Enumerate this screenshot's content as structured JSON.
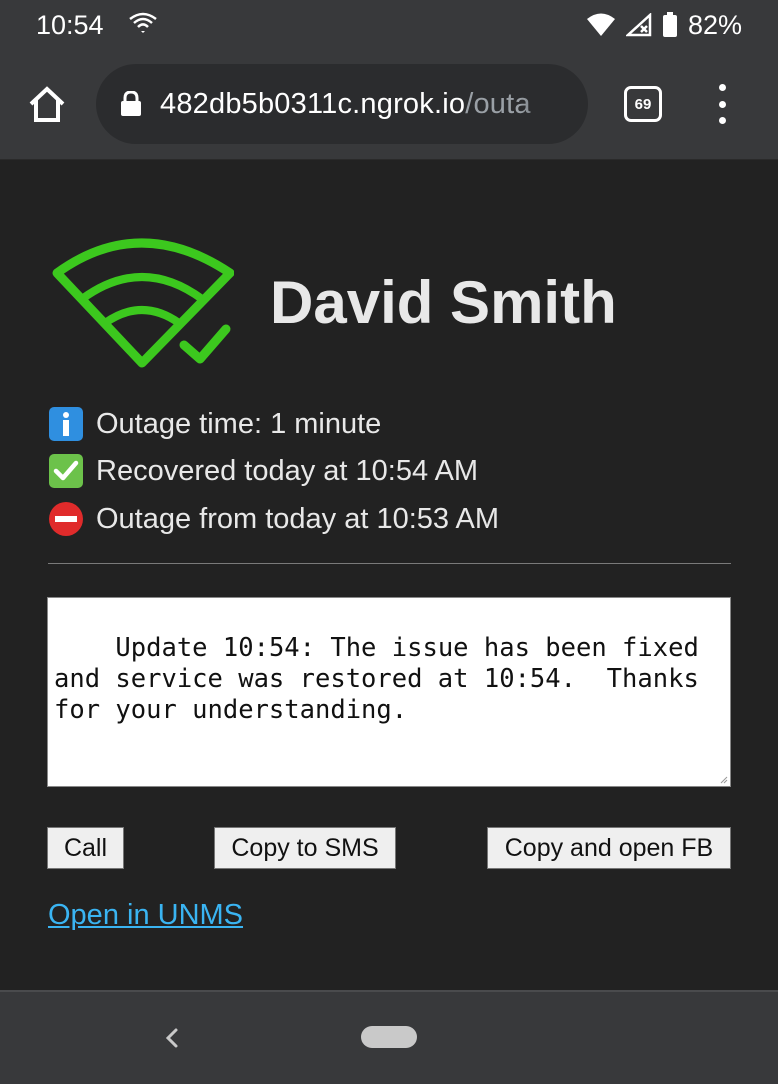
{
  "status_bar": {
    "time": "10:54",
    "battery": "82%"
  },
  "browser": {
    "url_host": "482db5b0311c.ngrok.io",
    "url_path": "/outa",
    "tab_count": "69"
  },
  "page": {
    "customer_name": "David Smith",
    "outage_time": "Outage time: 1 minute",
    "recovered": "Recovered today at 10:54 AM",
    "outage_from": "Outage from today at 10:53 AM",
    "message": "Update 10:54: The issue has been fixed and service was restored at 10:54.  Thanks for your understanding.",
    "buttons": {
      "call": "Call",
      "copy_sms": "Copy to SMS",
      "copy_fb": "Copy and open FB"
    },
    "unms_link": "Open in UNMS"
  },
  "colors": {
    "wifi_green": "#3cc81e",
    "link_blue": "#3ab4f2",
    "page_bg": "#222222"
  },
  "icons": {
    "info": "info-icon",
    "check": "check-mark-icon",
    "no_entry": "no-entry-icon"
  }
}
